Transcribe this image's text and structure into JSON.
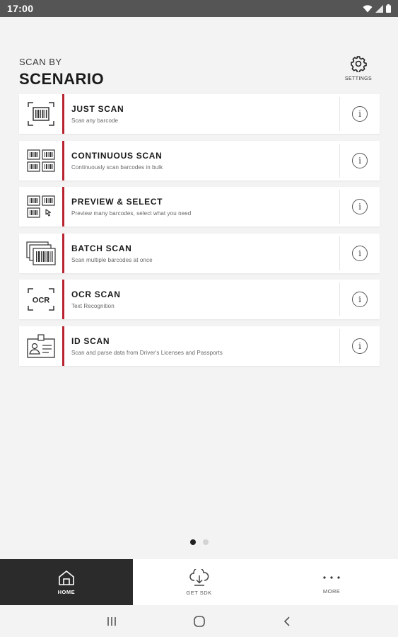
{
  "status_bar": {
    "time": "17:00"
  },
  "header": {
    "subtitle": "SCAN BY",
    "title": "SCENARIO",
    "settings_label": "SETTINGS"
  },
  "scenarios": [
    {
      "title": "JUST SCAN",
      "subtitle": "Scan any barcode",
      "icon": "barcode-frame-icon"
    },
    {
      "title": "CONTINUOUS SCAN",
      "subtitle": "Continuously scan barcodes in bulk",
      "icon": "multi-barcode-icon"
    },
    {
      "title": "PREVIEW & SELECT",
      "subtitle": "Preview many barcodes, select what you need",
      "icon": "barcode-select-icon"
    },
    {
      "title": "BATCH SCAN",
      "subtitle": "Scan multiple barcodes at once",
      "icon": "stacked-barcode-icon"
    },
    {
      "title": "OCR SCAN",
      "subtitle": "Text Recognition",
      "icon": "ocr-icon"
    },
    {
      "title": "ID SCAN",
      "subtitle": "Scan and parse data from Driver's Licenses and Passports",
      "icon": "id-card-icon"
    }
  ],
  "info_glyph": "i",
  "pager": {
    "pages": 2,
    "active": 1
  },
  "bottom_nav": [
    {
      "label": "HOME",
      "icon": "home-icon",
      "active": true
    },
    {
      "label": "GET SDK",
      "icon": "cloud-download-icon",
      "active": false
    },
    {
      "label": "MORE",
      "icon": "more-dots-icon",
      "active": false
    }
  ],
  "colors": {
    "accent": "#b8232f",
    "status_bar": "#555555",
    "nav_active": "#2b2b2b",
    "background": "#f3f3f3"
  }
}
